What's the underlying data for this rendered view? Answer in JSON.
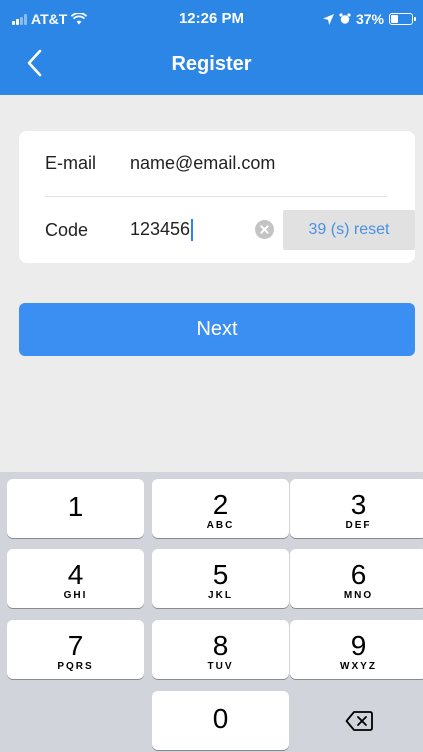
{
  "status_bar": {
    "carrier": "AT&T",
    "time": "12:26 PM",
    "battery": "37%",
    "battery_level": 0.37
  },
  "nav": {
    "title": "Register"
  },
  "form": {
    "email_label": "E-mail",
    "email_value": "name@email.com",
    "code_label": "Code",
    "code_value": "123456",
    "reset_label": "39 (s) reset"
  },
  "next_label": "Next",
  "keyboard": {
    "keys": [
      {
        "num": "1",
        "letters": ""
      },
      {
        "num": "2",
        "letters": "ABC"
      },
      {
        "num": "3",
        "letters": "DEF"
      },
      {
        "num": "4",
        "letters": "GHI"
      },
      {
        "num": "5",
        "letters": "JKL"
      },
      {
        "num": "6",
        "letters": "MNO"
      },
      {
        "num": "7",
        "letters": "PQRS"
      },
      {
        "num": "8",
        "letters": "TUV"
      },
      {
        "num": "9",
        "letters": "WXYZ"
      },
      {
        "num": "0",
        "letters": ""
      }
    ]
  },
  "colors": {
    "brand": "#2b86e5",
    "button": "#3b8ff3",
    "reset_text": "#4a90e2"
  },
  "icons": {
    "back": "chevron-left-icon",
    "clear": "clear-circle-icon",
    "delete": "backspace-icon"
  }
}
